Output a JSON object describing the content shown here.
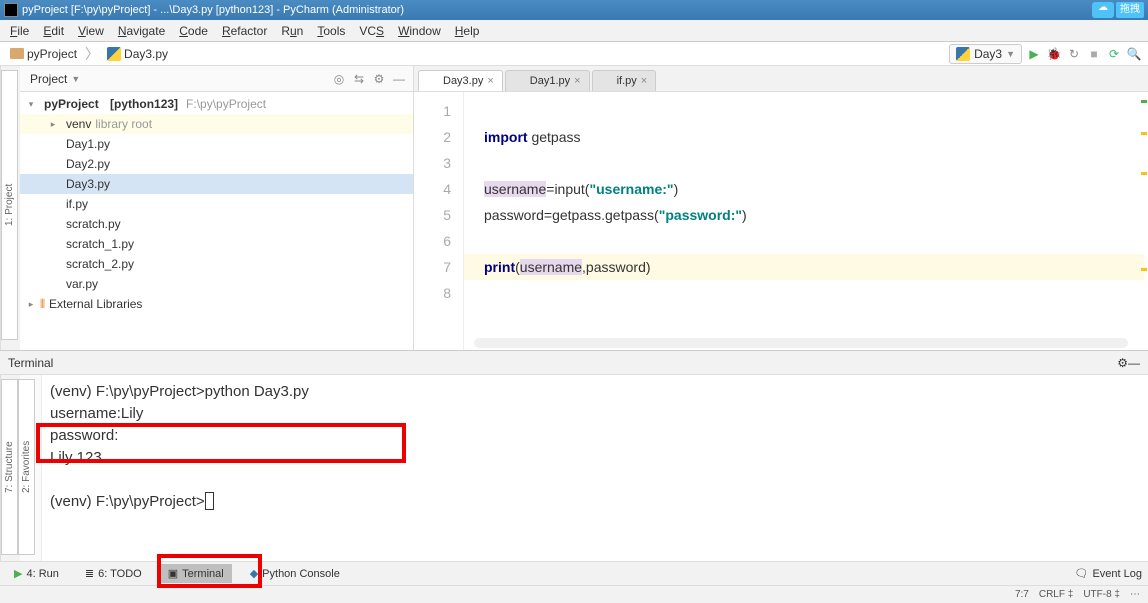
{
  "titlebar": {
    "text": "pyProject [F:\\py\\pyProject] - ...\\Day3.py [python123] - PyCharm (Administrator)",
    "drag_label": "拖拽"
  },
  "menu": [
    "File",
    "Edit",
    "View",
    "Navigate",
    "Code",
    "Refactor",
    "Run",
    "Tools",
    "VCS",
    "Window",
    "Help"
  ],
  "breadcrumb": {
    "project": "pyProject",
    "file": "Day3.py"
  },
  "run_config": "Day3",
  "project_panel": {
    "title": "Project",
    "root": {
      "name": "pyProject",
      "env": "[python123]",
      "path": "F:\\py\\pyProject"
    },
    "venv": {
      "name": "venv",
      "note": "library root"
    },
    "files": [
      "Day1.py",
      "Day2.py",
      "Day3.py",
      "if.py",
      "scratch.py",
      "scratch_1.py",
      "scratch_2.py",
      "var.py"
    ],
    "selected": "Day3.py",
    "external": "External Libraries"
  },
  "editor_tabs": [
    {
      "label": "Day3.py",
      "active": true
    },
    {
      "label": "Day1.py",
      "active": false
    },
    {
      "label": "if.py",
      "active": false
    }
  ],
  "code": {
    "lines": [
      "",
      "import getpass",
      "",
      "username=input(\"username:\")",
      "password=getpass.getpass(\"password:\")",
      "",
      "print(username,password)",
      ""
    ]
  },
  "terminal": {
    "title": "Terminal",
    "lines": [
      "(venv) F:\\py\\pyProject>python Day3.py",
      "username:Lily",
      "password:",
      "Lily 123",
      "",
      "(venv) F:\\py\\pyProject>"
    ]
  },
  "left_tabs": {
    "project": "1: Project",
    "structure": "7: Structure",
    "favorites": "2: Favorites"
  },
  "bottom_tabs": {
    "run": "4: Run",
    "todo": "6: TODO",
    "terminal": "Terminal",
    "python_console": "Python Console",
    "event_log": "Event Log"
  },
  "status": {
    "pos": "7:7",
    "crlf": "CRLF",
    "enc": "UTF-8"
  }
}
